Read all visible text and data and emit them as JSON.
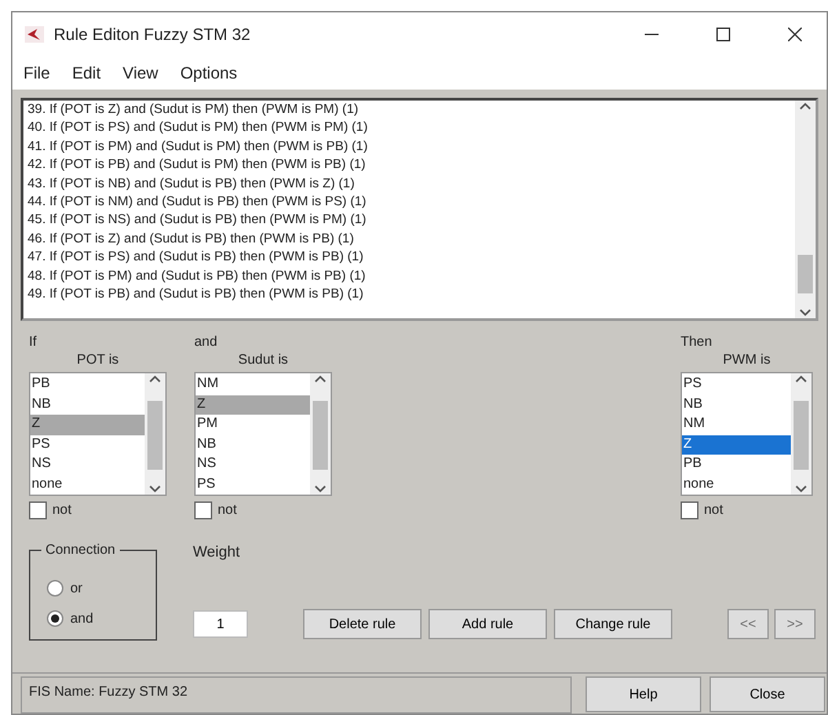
{
  "window": {
    "title": "Rule Editon Fuzzy STM 32"
  },
  "menu": [
    "File",
    "Edit",
    "View",
    "Options"
  ],
  "rules": [
    "39. If (POT is Z) and (Sudut is PM) then (PWM is PM) (1)",
    "40. If (POT is PS) and (Sudut is PM) then (PWM is PM) (1)",
    "41. If (POT is PM) and (Sudut is PM) then (PWM is PB) (1)",
    "42. If (POT is PB) and (Sudut is PM) then (PWM is PB) (1)",
    "43. If (POT is NB) and (Sudut is PB) then (PWM is Z) (1)",
    "44. If (POT is NM) and (Sudut is PB) then (PWM is PS) (1)",
    "45. If (POT is NS) and (Sudut is PB) then (PWM is PM) (1)",
    "46. If (POT is Z) and (Sudut is PB) then (PWM is PB) (1)",
    "47. If (POT is PS) and (Sudut is PB) then (PWM is PB) (1)",
    "48. If (POT is PM) and (Sudut is PB) then (PWM is PB) (1)",
    "49. If (POT is PB) and (Sudut is PB) then (PWM is PB) (1)"
  ],
  "variables": [
    {
      "kind": "input",
      "heading": "If",
      "label": "POT is",
      "focused": false,
      "not_checked": false,
      "not_label": "not",
      "options": [
        {
          "text": "PB",
          "selected": false
        },
        {
          "text": "NB",
          "selected": false
        },
        {
          "text": "Z",
          "selected": true
        },
        {
          "text": "PS",
          "selected": false
        },
        {
          "text": "NS",
          "selected": false
        },
        {
          "text": "none",
          "selected": false
        }
      ]
    },
    {
      "kind": "input",
      "heading": "and",
      "label": "Sudut is",
      "focused": false,
      "not_checked": false,
      "not_label": "not",
      "options": [
        {
          "text": "NM",
          "selected": false
        },
        {
          "text": "Z",
          "selected": true
        },
        {
          "text": "PM",
          "selected": false
        },
        {
          "text": "NB",
          "selected": false
        },
        {
          "text": "NS",
          "selected": false
        },
        {
          "text": "PS",
          "selected": false
        }
      ]
    },
    {
      "kind": "output",
      "heading": "Then",
      "label": "PWM is",
      "focused": true,
      "not_checked": false,
      "not_label": "not",
      "options": [
        {
          "text": "PS",
          "selected": false
        },
        {
          "text": "NB",
          "selected": false
        },
        {
          "text": "NM",
          "selected": false
        },
        {
          "text": "Z",
          "selected": true
        },
        {
          "text": "PB",
          "selected": false
        },
        {
          "text": "none",
          "selected": false
        }
      ]
    }
  ],
  "connection": {
    "title": "Connection",
    "options": [
      {
        "label": "or",
        "selected": false
      },
      {
        "label": "and",
        "selected": true
      }
    ]
  },
  "weight": {
    "label": "Weight",
    "value": "1"
  },
  "rule_buttons": [
    "Delete rule",
    "Add rule",
    "Change rule"
  ],
  "nav_buttons": [
    {
      "label": "<<",
      "disabled": true
    },
    {
      "label": ">>",
      "disabled": true
    }
  ],
  "status": "FIS Name: Fuzzy STM 32",
  "footer_buttons": [
    "Help",
    "Close"
  ]
}
